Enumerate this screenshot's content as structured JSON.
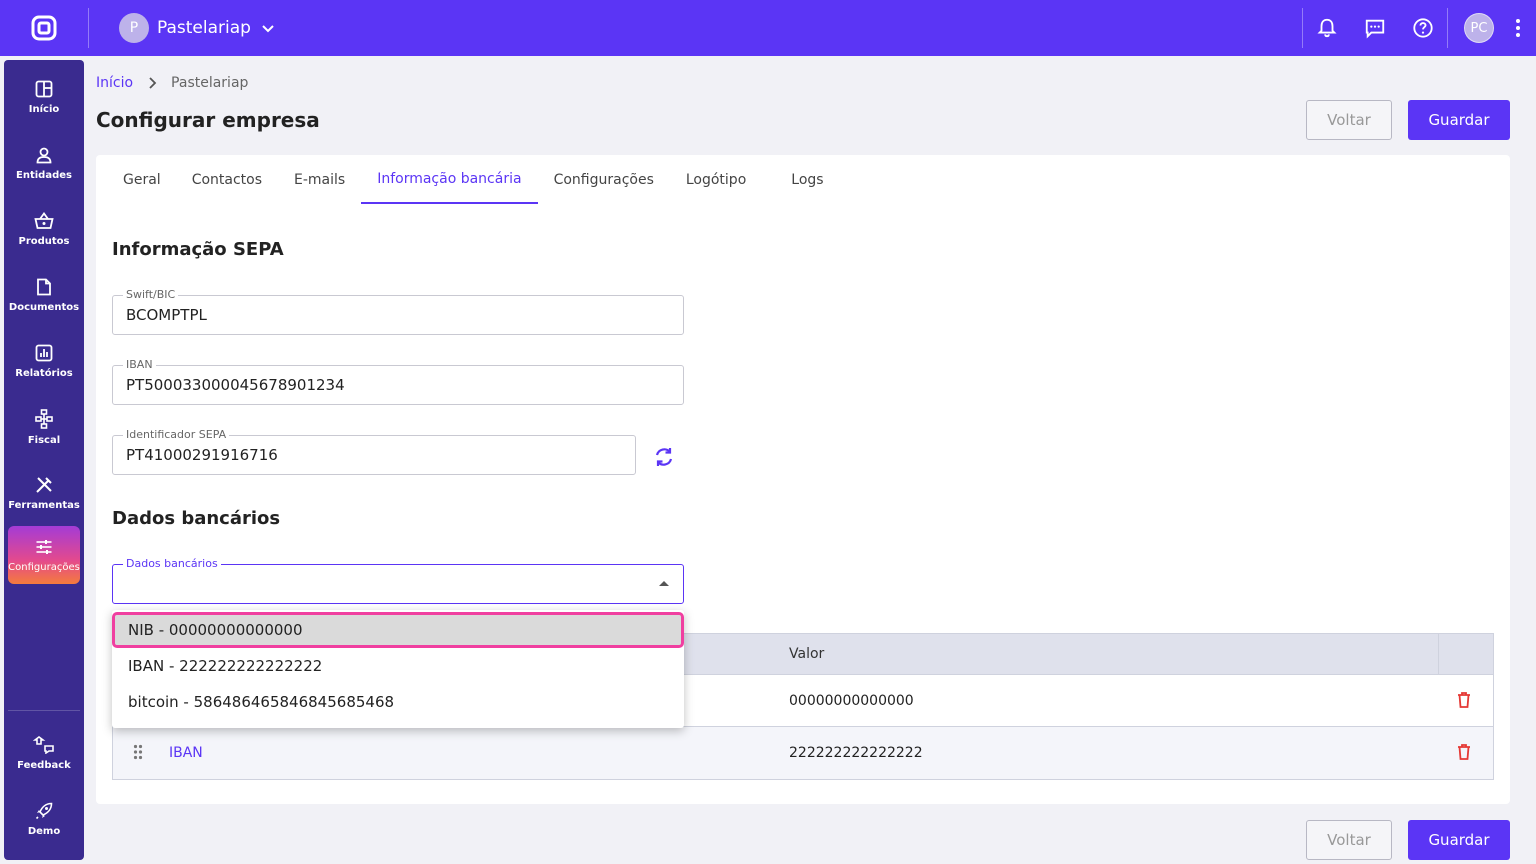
{
  "header": {
    "company_initial": "P",
    "company_name": "Pastelariap",
    "user_initials": "PC"
  },
  "sidebar": {
    "items": [
      {
        "label": "Início",
        "icon": "dashboard-icon"
      },
      {
        "label": "Entidades",
        "icon": "person-icon"
      },
      {
        "label": "Produtos",
        "icon": "basket-icon"
      },
      {
        "label": "Documentos",
        "icon": "document-icon"
      },
      {
        "label": "Relatórios",
        "icon": "chart-icon"
      },
      {
        "label": "Fiscal",
        "icon": "network-icon"
      },
      {
        "label": "Ferramentas",
        "icon": "tools-icon"
      },
      {
        "label": "Configurações",
        "icon": "sliders-icon",
        "active": true
      }
    ],
    "bottom": [
      {
        "label": "Feedback",
        "icon": "feedback-icon"
      },
      {
        "label": "Demo",
        "icon": "rocket-icon"
      }
    ]
  },
  "breadcrumb": {
    "home": "Início",
    "current": "Pastelariap"
  },
  "page": {
    "title": "Configurar empresa",
    "back_label": "Voltar",
    "save_label": "Guardar"
  },
  "tabs": [
    "Geral",
    "Contactos",
    "E-mails",
    "Informação bancária",
    "Configurações",
    "Logótipo",
    "Logs"
  ],
  "sepa": {
    "title": "Informação SEPA",
    "swift_label": "Swift/BIC",
    "swift_value": "BCOMPTPL",
    "iban_label": "IBAN",
    "iban_value": "PT50003300004567890123 4",
    "sepa_id_label": "Identificador SEPA",
    "sepa_id_value": "PT41000291916716"
  },
  "bank": {
    "title": "Dados bancários",
    "select_label": "Dados bancários",
    "options": [
      "NIB - 00000000000000",
      "IBAN - 222222222222222",
      "bitcoin - 5864864658468456854 68"
    ],
    "table": {
      "col_value": "Valor",
      "rows": [
        {
          "type": "NIB",
          "value": "00000000000000"
        },
        {
          "type": "IBAN",
          "value": "222222222222222"
        }
      ]
    }
  },
  "colors": {
    "primary": "#5b35f5",
    "highlight_border": "#f03fa0",
    "delete": "#e53935"
  }
}
